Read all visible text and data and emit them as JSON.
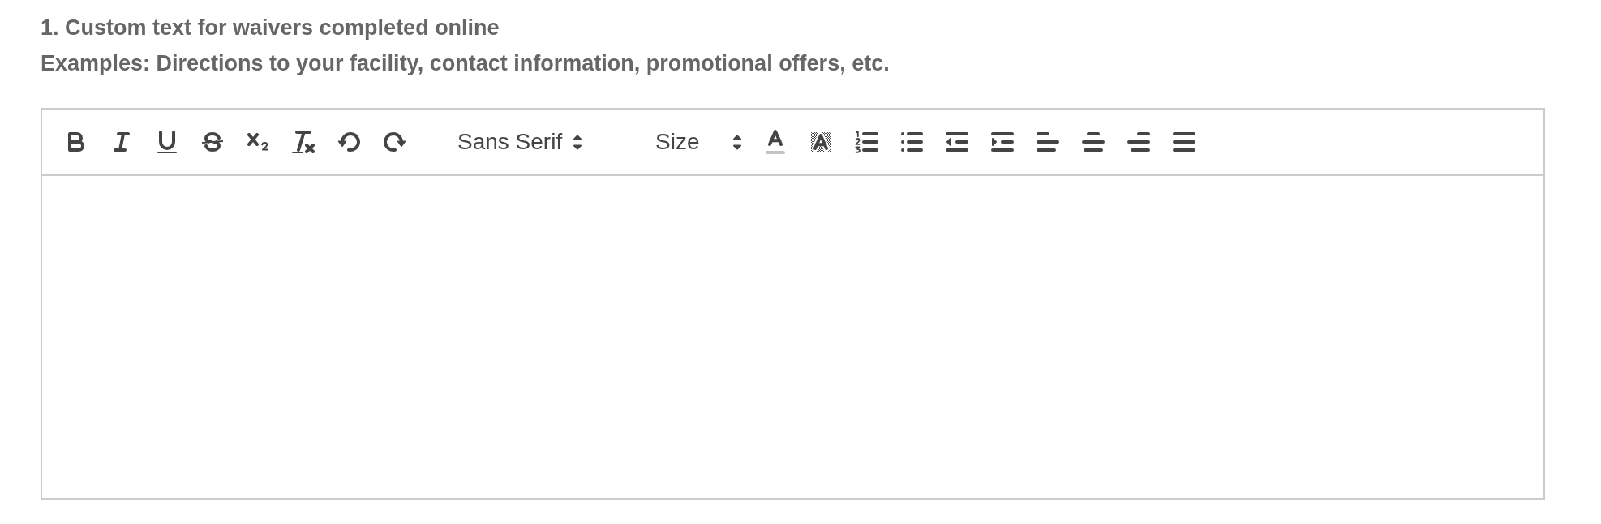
{
  "section": {
    "title": "1. Custom text for waivers completed online",
    "hint": "Examples: Directions to your facility, contact information, promotional offers, etc."
  },
  "editor": {
    "toolbar": [
      {
        "kind": "bold"
      },
      {
        "kind": "italic"
      },
      {
        "kind": "underline"
      },
      {
        "kind": "strike"
      },
      {
        "kind": "subscript"
      },
      {
        "kind": "clean"
      },
      {
        "kind": "undo"
      },
      {
        "kind": "redo"
      },
      {
        "kind": "font",
        "label": "Sans Serif"
      },
      {
        "kind": "size",
        "label": "Size"
      },
      {
        "kind": "color"
      },
      {
        "kind": "background"
      },
      {
        "kind": "ordered"
      },
      {
        "kind": "bullet"
      },
      {
        "kind": "outdent"
      },
      {
        "kind": "indent"
      },
      {
        "kind": "alignleft"
      },
      {
        "kind": "aligncenter"
      },
      {
        "kind": "alignright"
      },
      {
        "kind": "justify"
      }
    ]
  }
}
